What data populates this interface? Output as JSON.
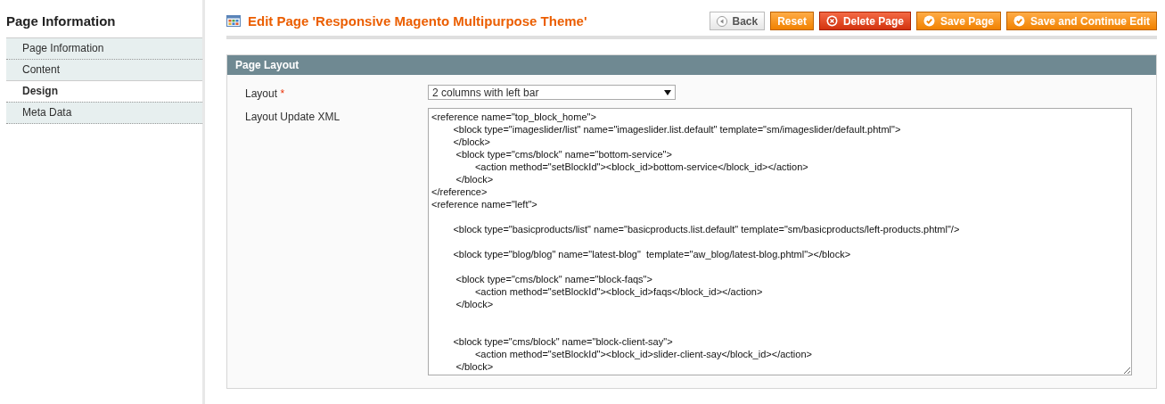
{
  "sidebar": {
    "title": "Page Information",
    "items": [
      {
        "label": "Page Information",
        "selected": false
      },
      {
        "label": "Content",
        "selected": false
      },
      {
        "label": "Design",
        "selected": true
      },
      {
        "label": "Meta Data",
        "selected": false
      }
    ]
  },
  "header": {
    "title": "Edit Page 'Responsive Magento Multipurpose Theme'",
    "buttons": [
      {
        "label": "Back",
        "kind": "back"
      },
      {
        "label": "Reset",
        "kind": "plain"
      },
      {
        "label": "Delete Page",
        "kind": "delete"
      },
      {
        "label": "Save Page",
        "kind": "save"
      },
      {
        "label": "Save and Continue Edit",
        "kind": "save"
      }
    ]
  },
  "section": {
    "title": "Page Layout",
    "fields": [
      {
        "kind": "select",
        "label": "Layout",
        "required_mark": "*",
        "value": "2 columns with left bar"
      },
      {
        "kind": "textarea",
        "label": "Layout Update XML",
        "value": "<reference name=\"top_block_home\">\n        <block type=\"imageslider/list\" name=\"imageslider.list.default\" template=\"sm/imageslider/default.phtml\">\n        </block>\n         <block type=\"cms/block\" name=\"bottom-service\">\n                <action method=\"setBlockId\"><block_id>bottom-service</block_id></action>\n         </block>\n</reference>\n<reference name=\"left\">\n\n        <block type=\"basicproducts/list\" name=\"basicproducts.list.default\" template=\"sm/basicproducts/left-products.phtml\"/>\n\n        <block type=\"blog/blog\" name=\"latest-blog\"  template=\"aw_blog/latest-blog.phtml\"></block>\n\n         <block type=\"cms/block\" name=\"block-faqs\">\n                <action method=\"setBlockId\"><block_id>faqs</block_id></action>\n         </block>\n\n\n        <block type=\"cms/block\" name=\"block-client-say\">\n                <action method=\"setBlockId\"><block_id>slider-client-say</block_id></action>\n         </block>"
      }
    ]
  }
}
